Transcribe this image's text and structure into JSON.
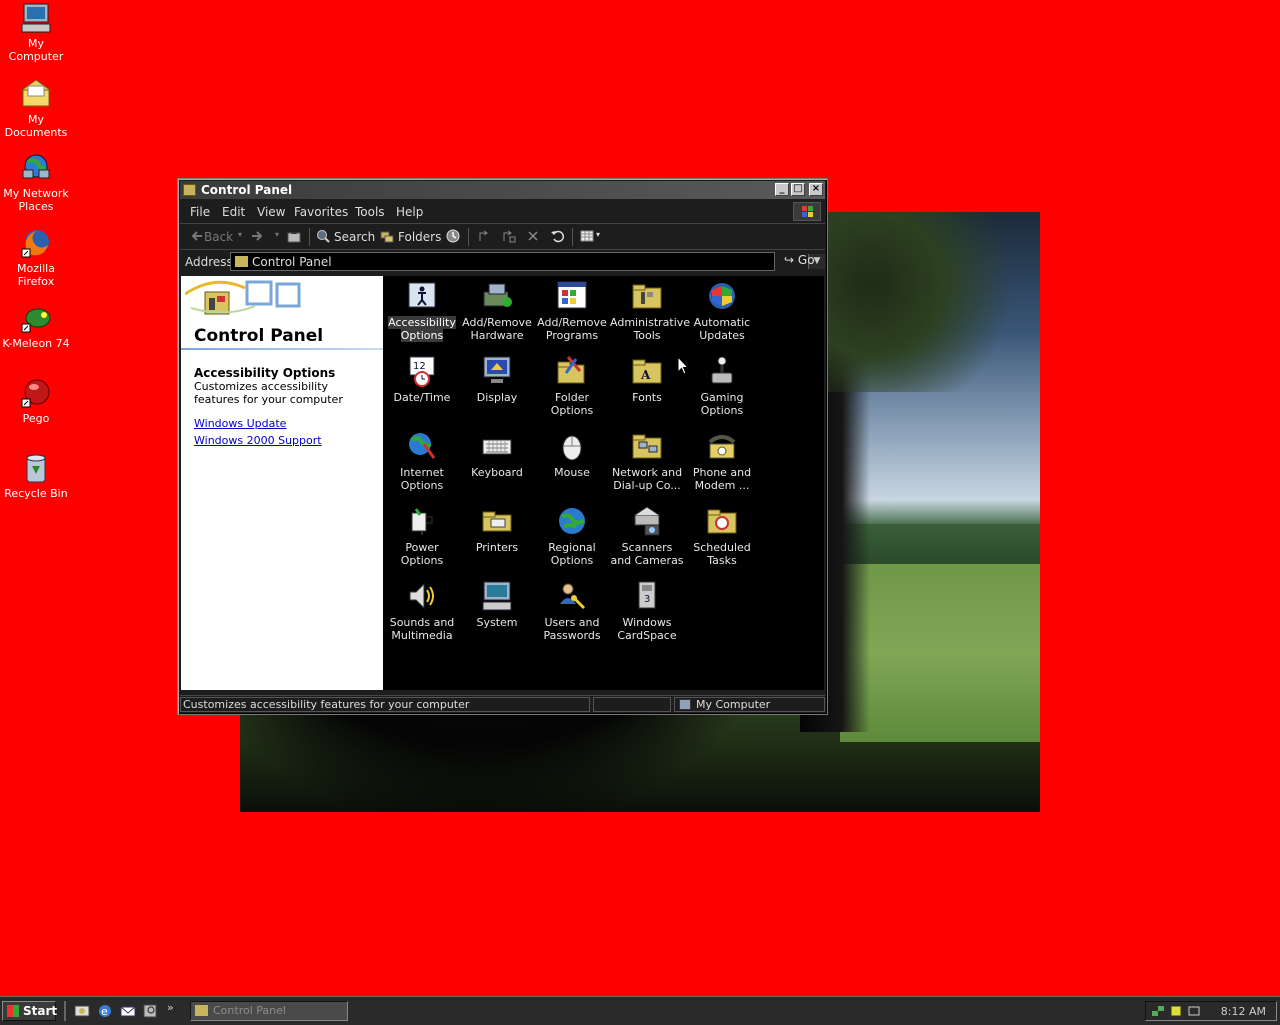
{
  "desktop": {
    "icons": [
      {
        "label": "My Computer",
        "icon": "my-computer-icon"
      },
      {
        "label": "My Documents",
        "icon": "my-documents-icon"
      },
      {
        "label": "My Network Places",
        "icon": "network-places-icon"
      },
      {
        "label": "Mozilla Firefox",
        "icon": "firefox-icon"
      },
      {
        "label": "K-Meleon 74",
        "icon": "kmeleon-icon"
      },
      {
        "label": "Pego",
        "icon": "pego-icon"
      },
      {
        "label": "Recycle Bin",
        "icon": "recycle-bin-icon"
      }
    ]
  },
  "window": {
    "title": "Control Panel",
    "menu": [
      "File",
      "Edit",
      "View",
      "Favorites",
      "Tools",
      "Help"
    ],
    "toolbar": {
      "back": "Back",
      "search": "Search",
      "folders": "Folders"
    },
    "address": {
      "label": "Address",
      "value": "Control Panel",
      "go": "Go"
    },
    "left_pane": {
      "title": "Control Panel",
      "selected_title": "Accessibility Options",
      "selected_desc": "Customizes accessibility features for your computer",
      "links": [
        "Windows Update",
        "Windows 2000 Support"
      ]
    },
    "items": [
      {
        "label": "Accessibility Options",
        "icon": "accessibility-icon",
        "selected": true
      },
      {
        "label": "Add/Remove Hardware",
        "icon": "hardware-icon"
      },
      {
        "label": "Add/Remove Programs",
        "icon": "programs-icon"
      },
      {
        "label": "Administrative Tools",
        "icon": "admin-tools-icon"
      },
      {
        "label": "Automatic Updates",
        "icon": "updates-icon"
      },
      {
        "label": "Date/Time",
        "icon": "date-time-icon"
      },
      {
        "label": "Display",
        "icon": "display-icon"
      },
      {
        "label": "Folder Options",
        "icon": "folder-options-icon"
      },
      {
        "label": "Fonts",
        "icon": "fonts-icon"
      },
      {
        "label": "Gaming Options",
        "icon": "gaming-icon"
      },
      {
        "label": "Internet Options",
        "icon": "internet-options-icon"
      },
      {
        "label": "Keyboard",
        "icon": "keyboard-icon"
      },
      {
        "label": "Mouse",
        "icon": "mouse-icon"
      },
      {
        "label": "Network and Dial-up Co...",
        "icon": "network-icon"
      },
      {
        "label": "Phone and Modem ...",
        "icon": "phone-modem-icon"
      },
      {
        "label": "Power Options",
        "icon": "power-icon"
      },
      {
        "label": "Printers",
        "icon": "printers-icon"
      },
      {
        "label": "Regional Options",
        "icon": "regional-icon"
      },
      {
        "label": "Scanners and Cameras",
        "icon": "scanner-icon"
      },
      {
        "label": "Scheduled Tasks",
        "icon": "scheduled-tasks-icon"
      },
      {
        "label": "Sounds and Multimedia",
        "icon": "sounds-icon"
      },
      {
        "label": "System",
        "icon": "system-icon"
      },
      {
        "label": "Users and Passwords",
        "icon": "users-icon"
      },
      {
        "label": "Windows CardSpace",
        "icon": "cardspace-icon"
      }
    ],
    "status": {
      "text": "Customizes accessibility features for your computer",
      "zone": "My Computer"
    }
  },
  "taskbar": {
    "start": "Start",
    "task": "Control Panel",
    "clock": "8:12 AM"
  },
  "colors": {
    "desktop_bg": "#ff0000",
    "window_bg": "#000000",
    "link": "#0000cc"
  }
}
